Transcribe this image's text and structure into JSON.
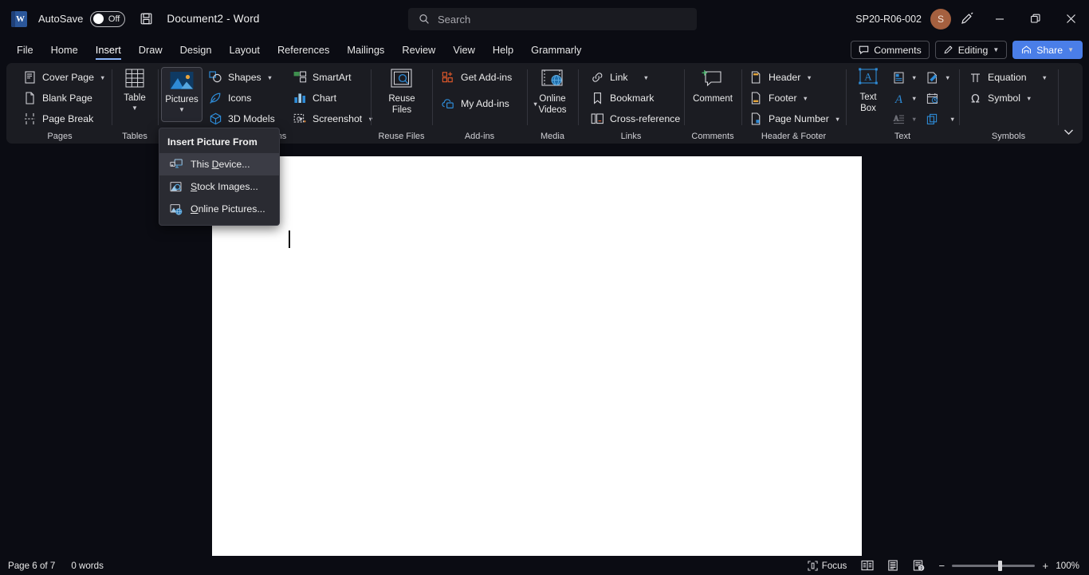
{
  "titlebar": {
    "app_icon": "word-logo-icon",
    "autosave_label": "AutoSave",
    "autosave_state": "Off",
    "save_icon": "save-icon",
    "document_title": "Document2  -  Word",
    "account_name": "SP20-R06-002",
    "avatar_initial": "S",
    "pen_icon": "pen-draw-icon",
    "minimize_icon": "minimize-icon",
    "restore_icon": "restore-icon",
    "close_icon": "close-icon"
  },
  "search": {
    "placeholder": "Search",
    "icon": "search-icon"
  },
  "tabs": {
    "items": [
      {
        "label": "File",
        "active": false
      },
      {
        "label": "Home",
        "active": false
      },
      {
        "label": "Insert",
        "active": true
      },
      {
        "label": "Draw",
        "active": false
      },
      {
        "label": "Design",
        "active": false
      },
      {
        "label": "Layout",
        "active": false
      },
      {
        "label": "References",
        "active": false
      },
      {
        "label": "Mailings",
        "active": false
      },
      {
        "label": "Review",
        "active": false
      },
      {
        "label": "View",
        "active": false
      },
      {
        "label": "Help",
        "active": false
      },
      {
        "label": "Grammarly",
        "active": false
      }
    ],
    "comments_label": "Comments",
    "editing_label": "Editing",
    "share_label": "Share"
  },
  "ribbon": {
    "groups": [
      {
        "name": "Pages",
        "label": "Pages"
      },
      {
        "name": "Tables",
        "label": "Tables"
      },
      {
        "name": "Illustrations",
        "label": "Illustrations"
      },
      {
        "name": "Reuse Files",
        "label": "Reuse Files"
      },
      {
        "name": "Add-ins",
        "label": "Add-ins"
      },
      {
        "name": "Media",
        "label": "Media"
      },
      {
        "name": "Links",
        "label": "Links"
      },
      {
        "name": "Comments",
        "label": "Comments"
      },
      {
        "name": "Header & Footer",
        "label": "Header & Footer"
      },
      {
        "name": "Text",
        "label": "Text"
      },
      {
        "name": "Symbols",
        "label": "Symbols"
      }
    ],
    "pages": {
      "cover_page": "Cover Page",
      "blank_page": "Blank Page",
      "page_break": "Page Break"
    },
    "tables": {
      "table": "Table"
    },
    "illustrations": {
      "pictures": "Pictures",
      "shapes": "Shapes",
      "icons": "Icons",
      "models3d": "3D Models",
      "smartart": "SmartArt",
      "chart": "Chart",
      "screenshot": "Screenshot"
    },
    "reuse_files": {
      "reuse_files_line1": "Reuse",
      "reuse_files_line2": "Files"
    },
    "addins": {
      "get_addins": "Get Add-ins",
      "my_addins": "My Add-ins"
    },
    "media": {
      "online_videos_line1": "Online",
      "online_videos_line2": "Videos"
    },
    "links": {
      "link": "Link",
      "bookmark": "Bookmark",
      "cross_reference": "Cross-reference"
    },
    "comments": {
      "comment": "Comment"
    },
    "header_footer": {
      "header": "Header",
      "footer": "Footer",
      "page_number": "Page Number"
    },
    "text": {
      "text_box_line1": "Text",
      "text_box_line2": "Box",
      "quick_parts_icon": "quick-parts-icon",
      "wordart_icon": "wordart-icon",
      "drop_cap_icon": "drop-cap-icon",
      "signature_line_icon": "signature-line-icon",
      "date_time_icon": "date-and-time-icon",
      "object_icon": "object-icon"
    },
    "symbols": {
      "equation": "Equation",
      "symbol": "Symbol"
    },
    "collapse_icon": "chevron-down-icon"
  },
  "menu": {
    "title": "Insert Picture From",
    "items": [
      {
        "pre": "This ",
        "accel": "D",
        "post": "evice...",
        "icon": "this-device-icon",
        "highlighted": true
      },
      {
        "pre": "",
        "accel": "S",
        "post": "tock Images...",
        "icon": "stock-images-icon",
        "highlighted": false
      },
      {
        "pre": "",
        "accel": "O",
        "post": "nline Pictures...",
        "icon": "online-pictures-icon",
        "highlighted": false
      }
    ]
  },
  "status": {
    "page_info": "Page 6 of 7",
    "word_count": "0 words",
    "focus_label": "Focus",
    "read_mode_icon": "read-mode-icon",
    "print_layout_icon": "print-layout-icon",
    "web_layout_icon": "web-layout-icon",
    "zoom_out": "−",
    "zoom_in": "+",
    "zoom_level": "100%"
  },
  "colors": {
    "accent_blue": "#4a7ee8",
    "tab_underline": "#8ab4f8",
    "ribbon_bg": "#1b1c22",
    "window_bg": "#0b0c13",
    "menu_bg": "#2a2b32",
    "page_bg": "#ffffff",
    "icon_blue": "#2e8bd6",
    "icon_orange": "#d8562a"
  }
}
